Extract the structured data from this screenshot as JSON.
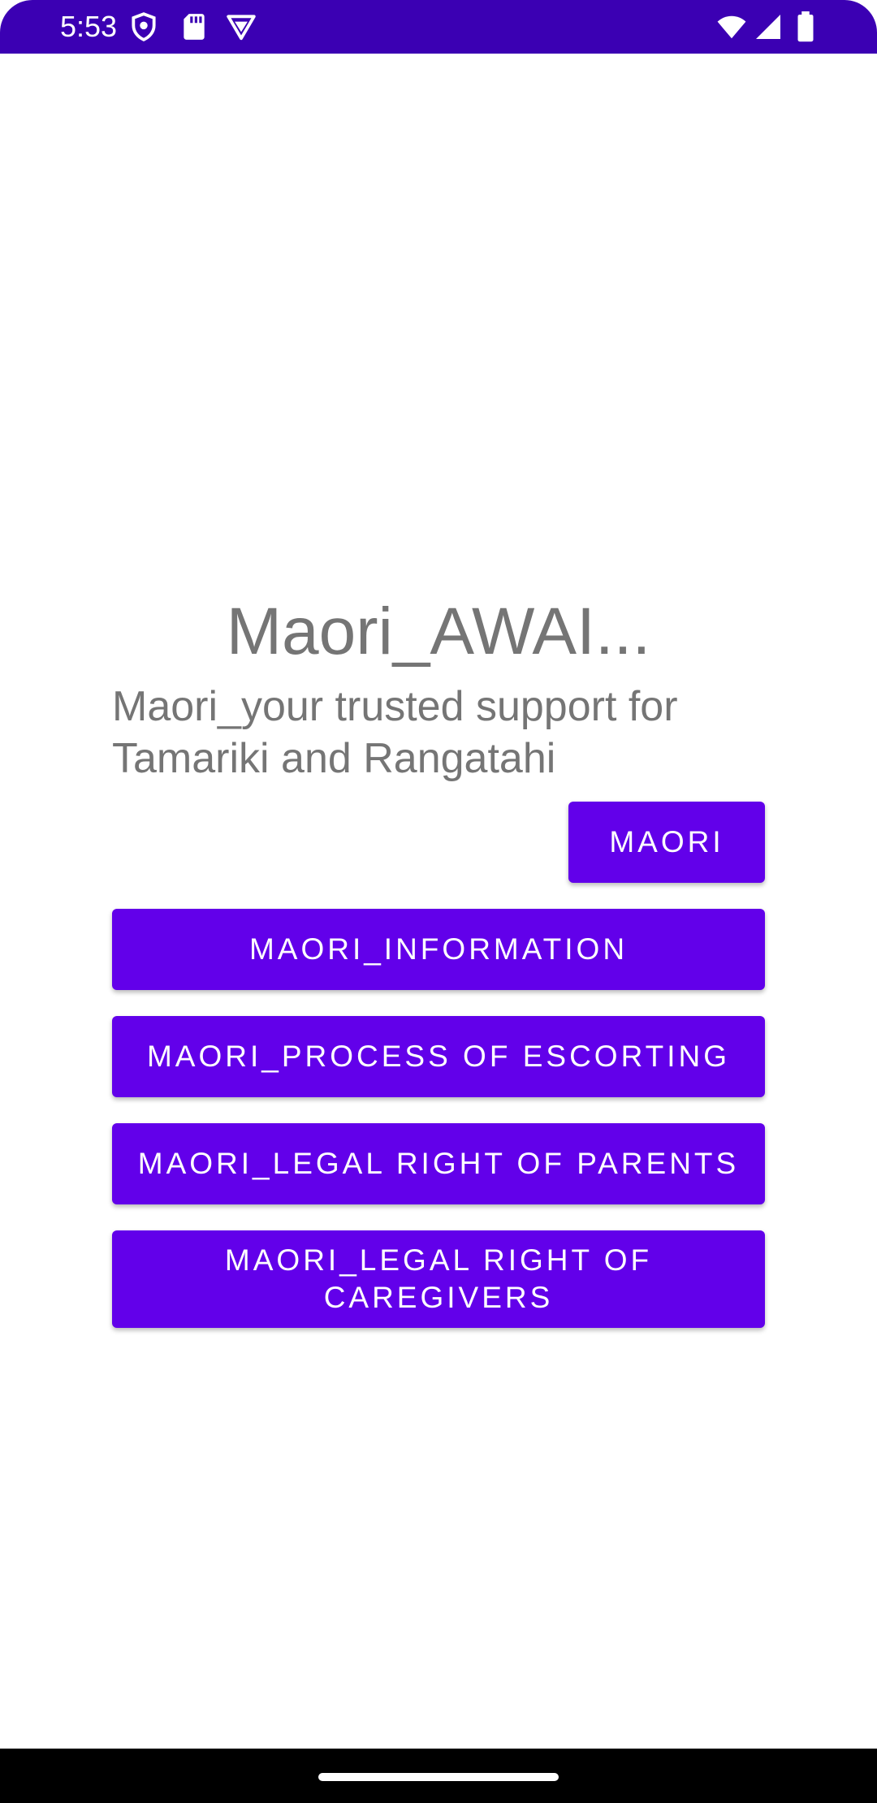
{
  "status_bar": {
    "time": "5:53",
    "background_color": "#3b00b3",
    "left_icons": [
      "shield-icon",
      "sd-card-icon",
      "vpn-icon"
    ],
    "right_icons": [
      "wifi-icon",
      "signal-icon",
      "battery-icon"
    ]
  },
  "main": {
    "title": "Maori_AWAI...",
    "subtitle": "Maori_your trusted support for Tamariki and Rangatahi",
    "buttons": {
      "maori": "MAORI",
      "information": "MAORI_INFORMATION",
      "process": "MAORI_PROCESS OF ESCORTING",
      "parents": "MAORI_LEGAL RIGHT OF PARENTS",
      "caregivers": "MAORI_LEGAL RIGHT OF CAREGIVERS"
    },
    "button_color": "#6200ea",
    "text_color": "#757575"
  }
}
